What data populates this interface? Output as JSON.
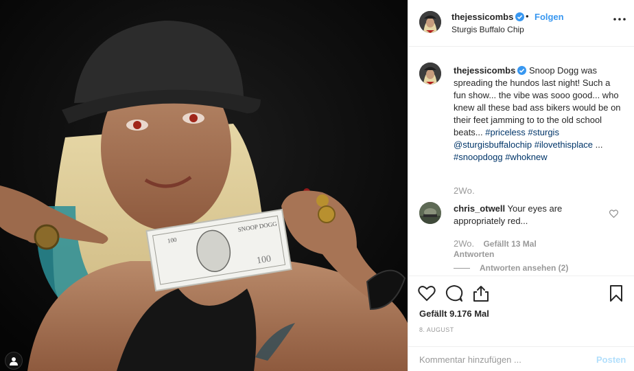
{
  "header": {
    "username": "thejessicombs",
    "separator": "•",
    "follow_label": "Folgen",
    "location": "Sturgis Buffalo Chip"
  },
  "caption": {
    "username": "thejessicombs",
    "text": "Snoop Dogg was spreading the hundos last night! Such a fun show... the vibe was sooo good... who knew all these bad ass bikers would be on their feet jamming to to the old school beats...",
    "tags": [
      "#priceless",
      "#sturgis",
      "@sturgisbuffalochip",
      "#ilovethisplace",
      "...",
      "#snoopdogg",
      "#whoknew"
    ],
    "time": "2Wo."
  },
  "comment": {
    "username": "chris_otwell",
    "text": "Your eyes are appropriately red...",
    "time": "2Wo.",
    "likes": "Gefällt 13 Mal",
    "reply_label": "Antworten",
    "view_replies": "Antworten ansehen (2)"
  },
  "actions": {
    "likes": "Gefällt 9.176 Mal",
    "date": "8. AUGUST"
  },
  "add_comment": {
    "placeholder": "Kommentar hinzufügen ...",
    "post_label": "Posten"
  },
  "icons": {
    "verified": "verified-badge-icon",
    "more": "more-options-icon",
    "like": "heart-icon",
    "comment": "comment-bubble-icon",
    "share": "share-icon",
    "save": "bookmark-icon",
    "user_tag": "user-tag-icon"
  },
  "colors": {
    "link": "#003569",
    "follow": "#3897f0",
    "muted": "#999999",
    "post_disabled": "#b2dffc"
  }
}
